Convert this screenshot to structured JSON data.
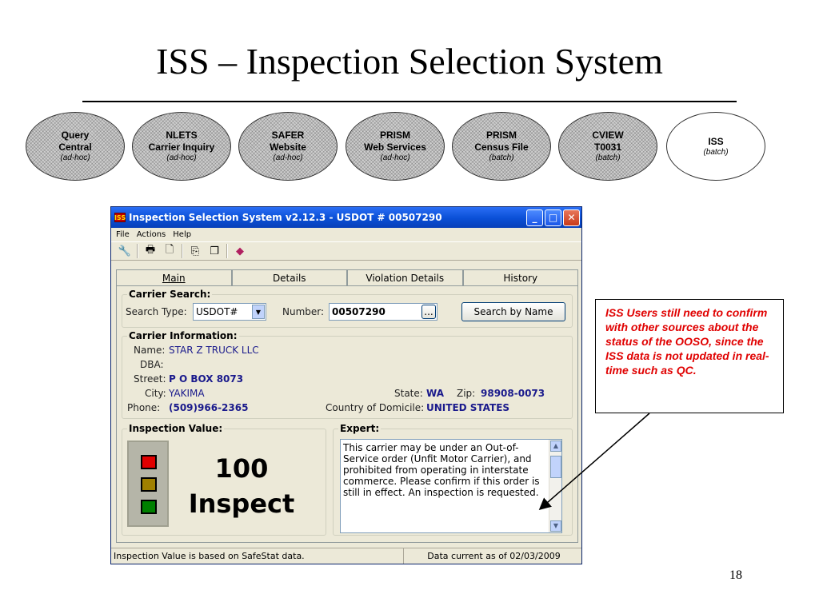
{
  "slide": {
    "title": "ISS – Inspection Selection System",
    "page_number": "18"
  },
  "ovals": [
    {
      "lines": [
        "Query",
        "Central"
      ],
      "sub": "(ad-hoc)",
      "shaded": true
    },
    {
      "lines": [
        "NLETS",
        "Carrier Inquiry"
      ],
      "sub": "(ad-hoc)",
      "shaded": true
    },
    {
      "lines": [
        "SAFER",
        "Website"
      ],
      "sub": "(ad-hoc)",
      "shaded": true
    },
    {
      "lines": [
        "PRISM",
        "Web Services"
      ],
      "sub": "(ad-hoc)",
      "shaded": true
    },
    {
      "lines": [
        "PRISM",
        "Census File"
      ],
      "sub": "(batch)",
      "shaded": true
    },
    {
      "lines": [
        "CVIEW",
        "T0031"
      ],
      "sub": "(batch)",
      "shaded": true
    },
    {
      "lines": [
        "ISS"
      ],
      "sub": "(batch)",
      "shaded": false
    }
  ],
  "window": {
    "app_icon": "ISS",
    "title": "Inspection Selection System v2.12.3 - USDOT # 00507290",
    "controls": {
      "minimize": "_",
      "maximize": "□",
      "close": "✕"
    },
    "menu": [
      "File",
      "Actions",
      "Help"
    ],
    "toolbar_icons": [
      "tools-icon",
      "printer-icon",
      "print-preview-icon",
      "copy-icon",
      "pages-icon",
      "book-icon"
    ],
    "tabs": [
      {
        "label": "Main",
        "active": true
      },
      {
        "label": "Details",
        "active": false
      },
      {
        "label": "Violation Details",
        "active": false
      },
      {
        "label": "History",
        "active": false
      }
    ],
    "carrier_search": {
      "heading": "Carrier Search:",
      "search_type_label": "Search Type:",
      "search_type_value": "USDOT#",
      "number_label": "Number:",
      "number_value": "00507290",
      "browse_label": "...",
      "search_by_name_label": "Search by Name"
    },
    "carrier_information": {
      "heading": "Carrier Information:",
      "name_label": "Name:",
      "name": "STAR Z TRUCK LLC",
      "dba_label": "DBA:",
      "dba": "",
      "street_label": "Street:",
      "street": "P O BOX 8073",
      "city_label": "City:",
      "city": "YAKIMA",
      "state_label": "State:",
      "state": "WA",
      "zip_label": "Zip:",
      "zip": "98908-0073",
      "phone_label": "Phone:",
      "phone": "(509)966-2365",
      "country_label": "Country of Domicile:",
      "country": "UNITED STATES"
    },
    "inspection_value": {
      "heading": "Inspection Value:",
      "value": "100",
      "recommendation": "Inspect",
      "lights": [
        {
          "color": "#e00000"
        },
        {
          "color": "#a08000"
        },
        {
          "color": "#008000"
        }
      ]
    },
    "expert": {
      "heading": "Expert:",
      "text": "This carrier may be under an Out-of-Service order (Unfit Motor Carrier), and prohibited from operating in interstate commerce. Please confirm if this order is still in effect. An inspection is requested."
    },
    "status_bar": {
      "left": "Inspection Value is based on SafeStat data.",
      "right": "Data current as of 02/03/2009"
    }
  },
  "callout": {
    "text": "ISS Users still need to confirm with other sources about the status of the OOSO, since the ISS data is not updated in real-time such as QC."
  }
}
